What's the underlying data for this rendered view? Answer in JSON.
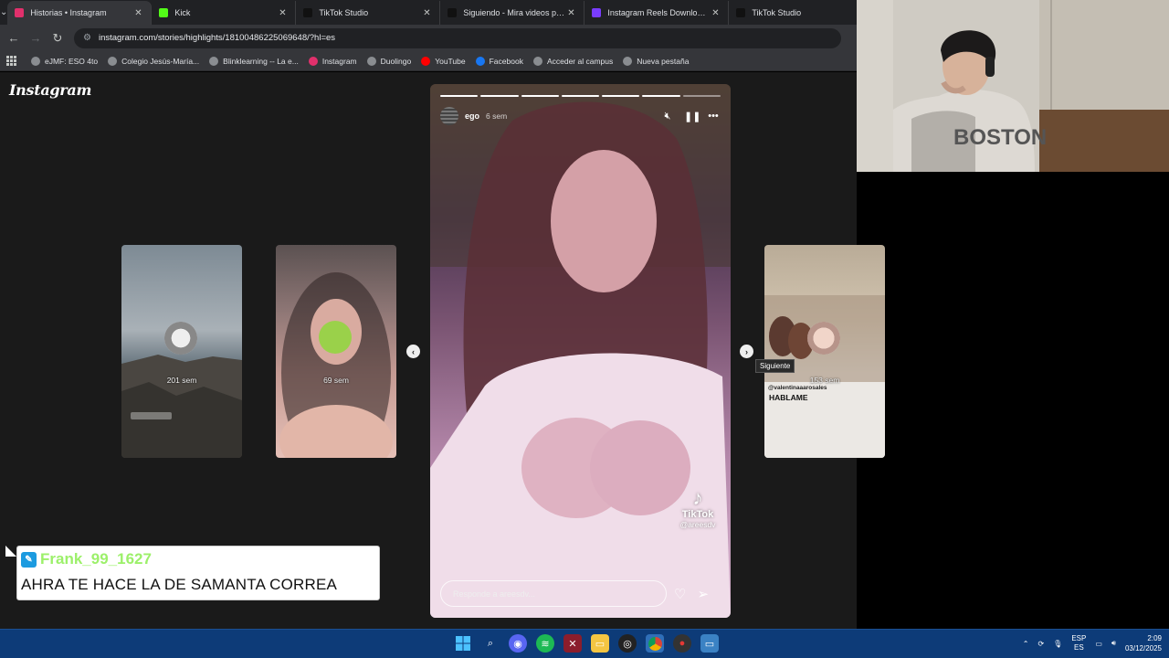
{
  "browser": {
    "tabs": [
      {
        "title": "Historias • Instagram",
        "icon": "instagram-icon",
        "color": "#e1306c",
        "active": true
      },
      {
        "title": "Kick",
        "icon": "kick-icon",
        "color": "#53fc18",
        "active": false
      },
      {
        "title": "TikTok Studio",
        "icon": "tiktok-icon",
        "color": "#111111",
        "active": false
      },
      {
        "title": "Siguiendo - Mira videos publica",
        "icon": "tiktok-icon",
        "color": "#111111",
        "active": false
      },
      {
        "title": "Instagram Reels Downloader O",
        "icon": "downloader-icon",
        "color": "#7a3cff",
        "active": false
      },
      {
        "title": "TikTok Studio",
        "icon": "tiktok-icon",
        "color": "#111111",
        "active": false
      }
    ],
    "url": "instagram.com/stories/highlights/18100486225069648/?hl=es",
    "bookmarks": [
      {
        "label": "eJMF: ESO 4to",
        "icon": "globe-icon"
      },
      {
        "label": "Colegio Jesús-María...",
        "icon": "globe-icon"
      },
      {
        "label": "Blinklearning -- La e...",
        "icon": "globe-icon"
      },
      {
        "label": "Instagram",
        "icon": "instagram-icon"
      },
      {
        "label": "Duolingo",
        "icon": "globe-icon"
      },
      {
        "label": "YouTube",
        "icon": "youtube-icon"
      },
      {
        "label": "Facebook",
        "icon": "facebook-icon"
      },
      {
        "label": "Acceder al campus",
        "icon": "globe-icon"
      },
      {
        "label": "Nueva pestaña",
        "icon": "globe-icon"
      }
    ]
  },
  "instagram": {
    "logo": "Instagram",
    "left_stories": [
      {
        "ago": "201 sem"
      },
      {
        "ago": "69 sem"
      }
    ],
    "right_story": {
      "ago": "153 sem",
      "sticker_user": "@valentinaaarosales",
      "text": "HABLAME"
    },
    "story": {
      "username": "ego",
      "time": "6 sem",
      "progress_segments": 7,
      "progress_done": 6,
      "watermark_name": "TikTok",
      "watermark_handle": "@areesdv",
      "reply_placeholder": "Responde a areesdv..."
    },
    "tooltip": "Siguiente"
  },
  "chat": {
    "username": "Frank_99_1627",
    "message": "AHRA TE HACE LA DE SAMANTA CORREA"
  },
  "taskbar": {
    "lang_top": "ESP",
    "lang_bottom": "ES",
    "time": "2:09",
    "date": "03/12/2025"
  }
}
